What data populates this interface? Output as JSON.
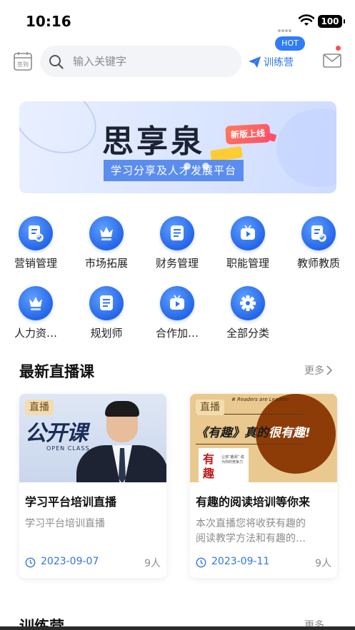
{
  "status_bar": {
    "time": "10:16",
    "battery": "100"
  },
  "header": {
    "checkin_label": "签到",
    "search_placeholder": "输入关键字",
    "camp_link_label": "训练营",
    "hot_badge": "HOT"
  },
  "banner": {
    "title": "思享泉",
    "subtitle": "学习分享及人才发展平台",
    "new_badge": "新版上线"
  },
  "categories": [
    {
      "label": "营销管理",
      "icon": "doc-check-icon"
    },
    {
      "label": "市场拓展",
      "icon": "crown-icon"
    },
    {
      "label": "财务管理",
      "icon": "list-doc-icon"
    },
    {
      "label": "职能管理",
      "icon": "play-tv-icon"
    },
    {
      "label": "教师教质",
      "icon": "doc-check-icon"
    },
    {
      "label": "人力资…",
      "icon": "crown-icon"
    },
    {
      "label": "规划师",
      "icon": "list-doc-icon"
    },
    {
      "label": "合作加…",
      "icon": "play-tv-icon"
    },
    {
      "label": "全部分类",
      "icon": "gear-icon"
    }
  ],
  "live_section": {
    "title": "最新直播课",
    "more": "更多",
    "courses": [
      {
        "badge": "直播",
        "thumb_text": "公开课",
        "thumb_sub": "OPEN CLASS",
        "title": "学习平台培训直播",
        "desc_lines": [
          "学习平台培训直播"
        ],
        "date": "2023-09-07",
        "count": "9人"
      },
      {
        "badge": "直播",
        "thumb_top": "# Readers are Leaders",
        "thumb_title_a": "《有趣》真的",
        "thumb_title_b": "很有趣!",
        "thumb_book_chars": [
          "有",
          "趣"
        ],
        "thumb_book_small": "让孩“趣阅” 成为你的竞争力",
        "title": "有趣的阅读培训等你来",
        "desc_lines": [
          "本次直播您将收获有趣的",
          "阅读教学方法和有趣的…"
        ],
        "date": "2023-09-11",
        "count": "9人"
      }
    ]
  },
  "camp_section": {
    "title": "训练营",
    "more": "更多"
  },
  "colors": {
    "accent": "#2f74e8",
    "badge": "#2f7cf6",
    "live_badge": "#f3dcb0"
  }
}
